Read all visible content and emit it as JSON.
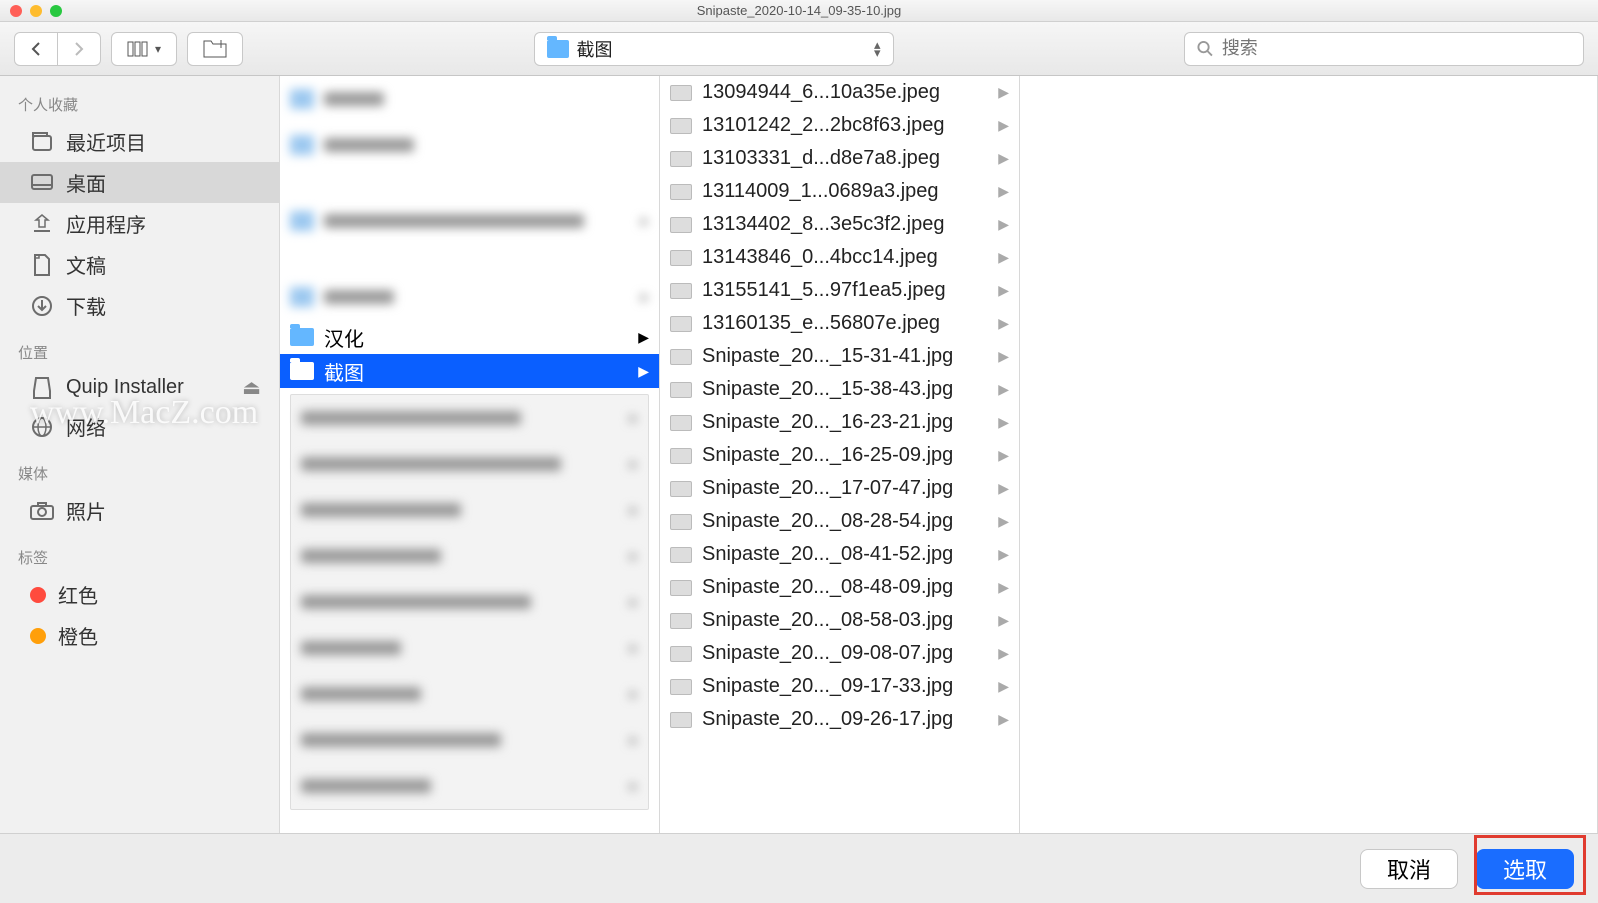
{
  "window": {
    "title": "Snipaste_2020-10-14_09-35-10.jpg"
  },
  "toolbar": {
    "path_label": "截图",
    "search_placeholder": "搜索"
  },
  "sidebar": {
    "sections": [
      {
        "title": "个人收藏"
      },
      {
        "title": "位置"
      },
      {
        "title": "媒体"
      },
      {
        "title": "标签"
      }
    ],
    "favorites": [
      {
        "label": "最近项目"
      },
      {
        "label": "桌面"
      },
      {
        "label": "应用程序"
      },
      {
        "label": "文稿"
      },
      {
        "label": "下载"
      }
    ],
    "locations": [
      {
        "label": "Quip Installer"
      },
      {
        "label": "网络"
      }
    ],
    "media": [
      {
        "label": "照片"
      }
    ],
    "tags": [
      {
        "label": "红色",
        "color": "#ff4b3e"
      },
      {
        "label": "橙色",
        "color": "#ff9f0a"
      }
    ]
  },
  "col1": {
    "visible_folder_1": "汉化",
    "selected_folder": "截图"
  },
  "col2_files": [
    "13094944_6...10a35e.jpeg",
    "13101242_2...2bc8f63.jpeg",
    "13103331_d...d8e7a8.jpeg",
    "13114009_1...0689a3.jpeg",
    "13134402_8...3e5c3f2.jpeg",
    "13143846_0...4bcc14.jpeg",
    "13155141_5...97f1ea5.jpeg",
    "13160135_e...56807e.jpeg",
    "Snipaste_20..._15-31-41.jpg",
    "Snipaste_20..._15-38-43.jpg",
    "Snipaste_20..._16-23-21.jpg",
    "Snipaste_20..._16-25-09.jpg",
    "Snipaste_20..._17-07-47.jpg",
    "Snipaste_20..._08-28-54.jpg",
    "Snipaste_20..._08-41-52.jpg",
    "Snipaste_20..._08-48-09.jpg",
    "Snipaste_20..._08-58-03.jpg",
    "Snipaste_20..._09-08-07.jpg",
    "Snipaste_20..._09-17-33.jpg",
    "Snipaste_20..._09-26-17.jpg"
  ],
  "footer": {
    "cancel": "取消",
    "select": "选取"
  },
  "watermark": "www.MacZ.com"
}
